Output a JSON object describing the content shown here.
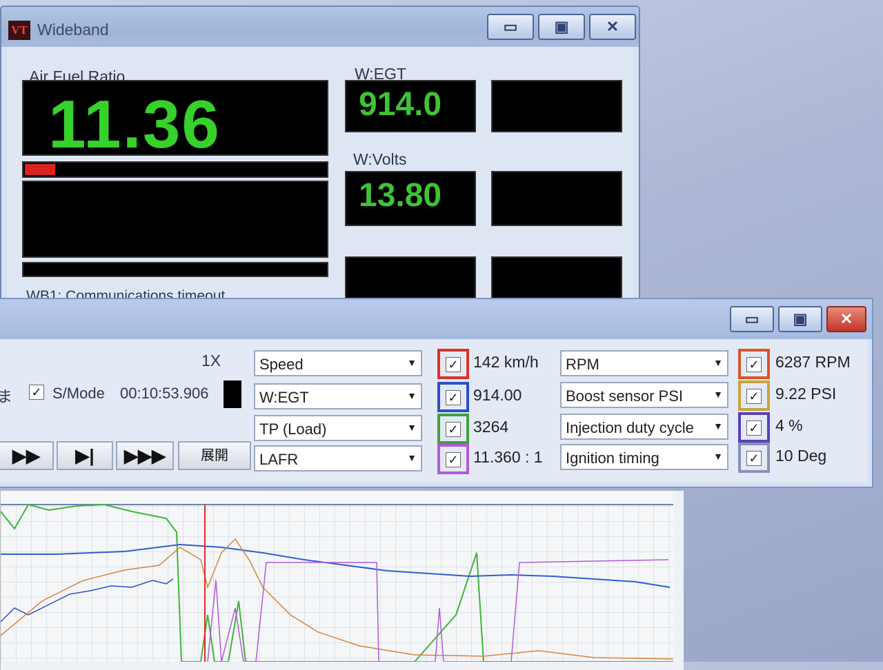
{
  "wideband": {
    "logo": "VT",
    "title": "Wideband",
    "buttons": {
      "minimize": "▭",
      "maximize": "▣",
      "close": "✕"
    },
    "afr_label": "Air Fuel Ratio",
    "afr_value": "11.36",
    "afr_bar_fraction": 0.1,
    "egt_label": "W:EGT",
    "egt_value": "914.0",
    "volts_label": "W:Volts",
    "volts_value": "13.80",
    "status": "WB1: Communications timeout."
  },
  "logger": {
    "buttons": {
      "minimize": "▭",
      "maximize": "▣",
      "close": "✕"
    },
    "speed_multiplier": "1X",
    "smode_partial_text": "ま",
    "smode_label": "S/Mode",
    "smode_checked": "✓",
    "elapsed_time": "00:10:53.906",
    "playback": {
      "fast_forward": "▶▶",
      "step": "▶|",
      "faster_forward": "▶▶▶",
      "expand": "展開"
    },
    "channels_left": [
      {
        "select": "Speed",
        "value": "142 km/h",
        "color": "#d8322a",
        "check": "✓"
      },
      {
        "select": "W:EGT",
        "value": "914.00",
        "color": "#2d4fc4",
        "check": "✓"
      },
      {
        "select": "TP (Load)",
        "value": "3264",
        "color": "#3da23a",
        "check": "✓"
      },
      {
        "select": "LAFR",
        "value": "11.360 : 1",
        "color": "#b05ad8",
        "check": "✓"
      }
    ],
    "channels_right": [
      {
        "select": "RPM",
        "value": "6287 RPM",
        "color": "#d8542a",
        "check": "✓"
      },
      {
        "select": "Boost sensor PSI",
        "value": "9.22 PSI",
        "color": "#c9a43a",
        "check": "✓"
      },
      {
        "select": "Injection duty cycle",
        "value": "4 %",
        "color": "#5b3fb8",
        "check": "✓"
      },
      {
        "select": "Ignition timing",
        "value": "10 Deg",
        "color": "#8791b4",
        "check": "✓"
      }
    ],
    "dropdown_arrow": "▼"
  }
}
